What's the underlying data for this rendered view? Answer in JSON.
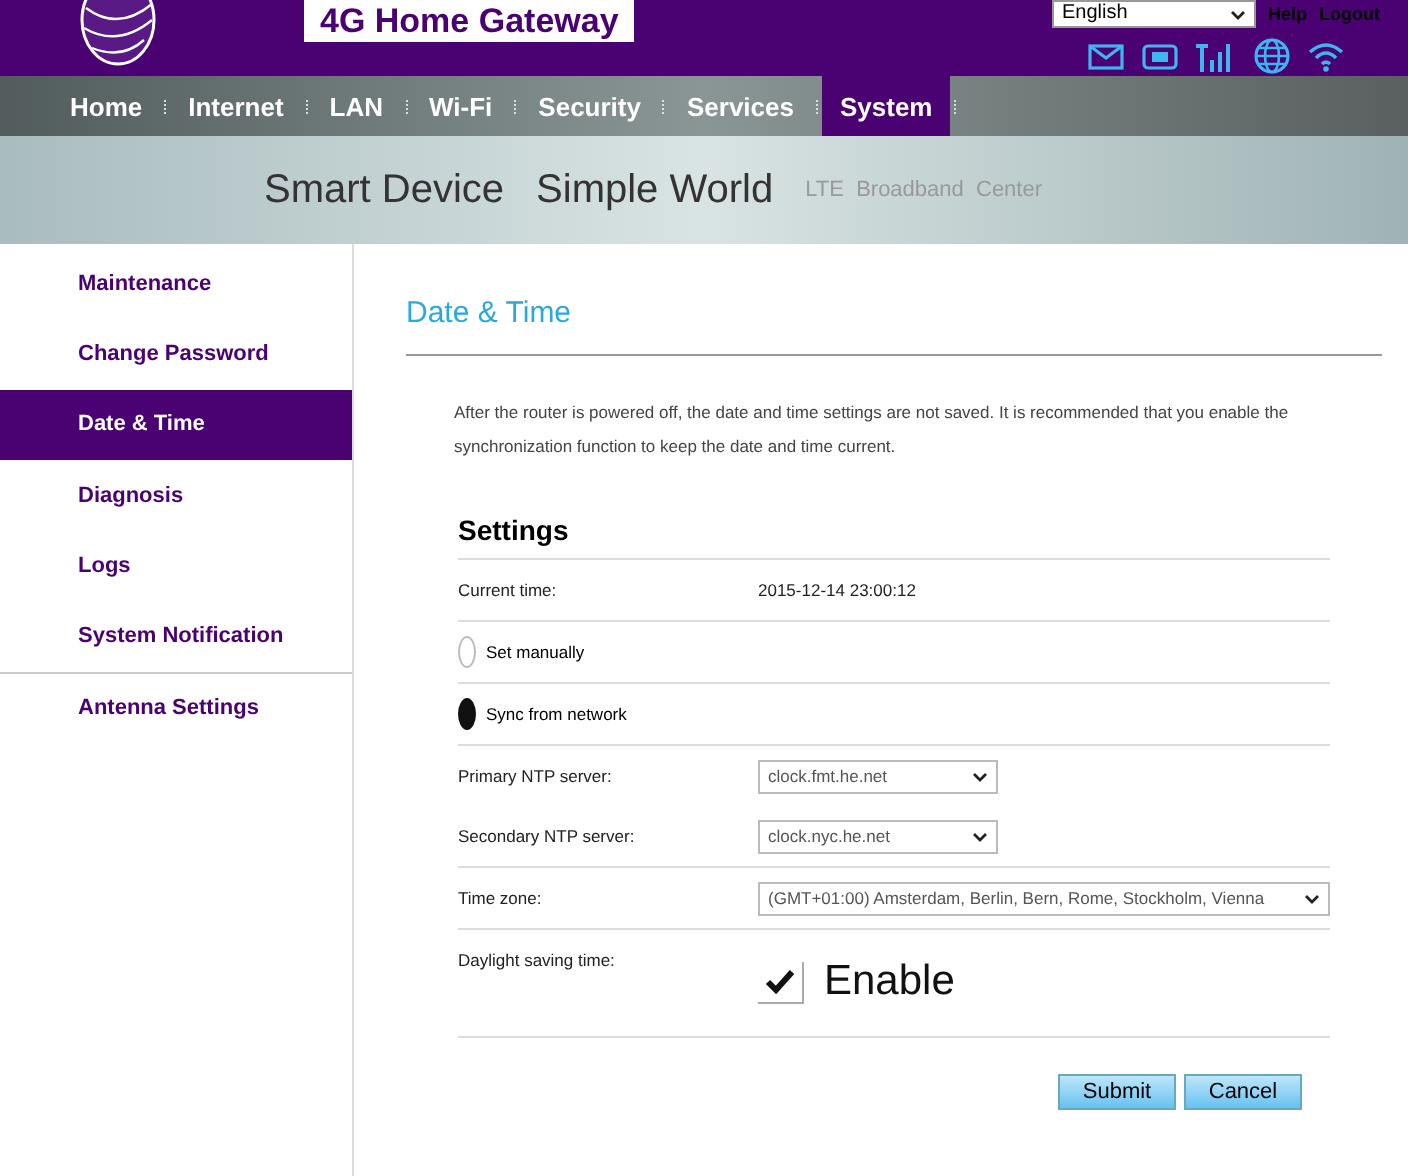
{
  "header": {
    "title": "4G Home Gateway",
    "language": "English",
    "links": [
      "Help",
      "Logout"
    ]
  },
  "nav": [
    {
      "label": "Home",
      "selected": false
    },
    {
      "label": "Internet",
      "selected": false
    },
    {
      "label": "LAN",
      "selected": false
    },
    {
      "label": "Wi-Fi",
      "selected": false
    },
    {
      "label": "Security",
      "selected": false
    },
    {
      "label": "Services",
      "selected": false
    },
    {
      "label": "System",
      "selected": true
    }
  ],
  "banner": {
    "slogan_1": "Smart Device",
    "slogan_2": "Simple World",
    "subtitle": "LTE  Broadband  Center"
  },
  "sidebar": {
    "items": [
      {
        "label": "Maintenance",
        "selected": false
      },
      {
        "label": "Change Password",
        "selected": false
      },
      {
        "label": "Date & Time",
        "selected": true
      },
      {
        "label": "Diagnosis",
        "selected": false
      },
      {
        "label": "Logs",
        "selected": false
      },
      {
        "label": "System Notification",
        "selected": false
      },
      {
        "label": "Antenna Settings",
        "selected": false
      }
    ]
  },
  "page": {
    "title": "Date & Time",
    "description": "After the router is powered off, the date and time settings are not saved. It is recommended that you enable the synchronization function to keep the date and time current.",
    "section": "Settings",
    "current_time": {
      "label": "Current time:",
      "value": "2015-12-14 23:00:12"
    },
    "mode": [
      {
        "label": "Set manually",
        "selected": false
      },
      {
        "label": "Sync from network",
        "selected": true
      }
    ],
    "primary_ntp": {
      "label": "Primary NTP server:",
      "value": "clock.fmt.he.net"
    },
    "secondary_ntp": {
      "label": "Secondary NTP server:",
      "value": "clock.nyc.he.net"
    },
    "time_zone": {
      "label": "Time zone:",
      "value": "(GMT+01:00) Amsterdam, Berlin, Bern, Rome, Stockholm, Vienna"
    },
    "dst": {
      "label": "Daylight saving time:",
      "option": "Enable",
      "checked": true
    },
    "buttons": [
      "Submit",
      "Cancel"
    ]
  }
}
